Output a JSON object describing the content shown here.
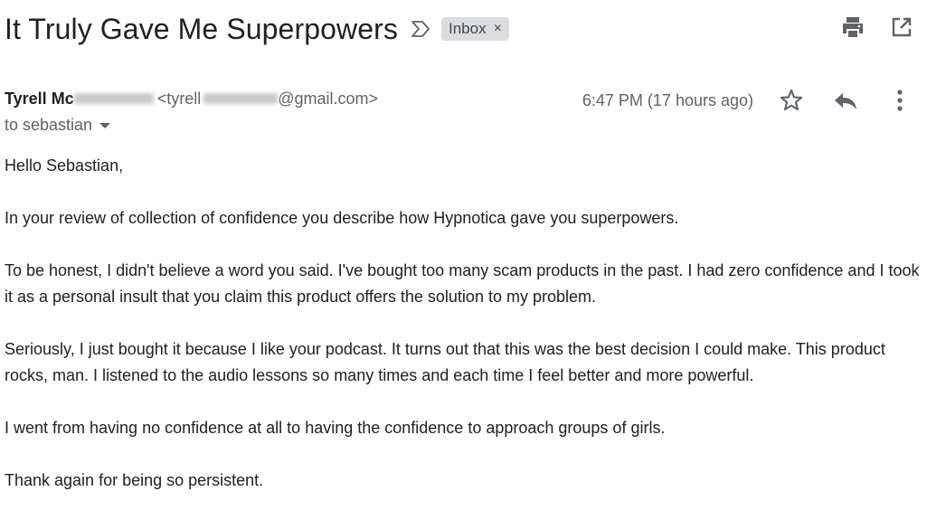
{
  "email": {
    "subject": "It Truly Gave Me Superpowers",
    "label": "Inbox",
    "label_remove": "×",
    "sender_name": "Tyrell Mc",
    "sender_email_prefix": "<tyrell",
    "sender_email_suffix": "@gmail.com>",
    "timestamp": "6:47 PM (17 hours ago)",
    "recipient": "to sebastian",
    "body": [
      "Hello Sebastian,",
      "In your review of collection of confidence you describe how Hypnotica gave you superpowers.",
      "To be honest, I didn't believe a word you said. I've bought too many scam products in the past. I had zero confidence and I took it as a personal insult that you claim this product offers the solution to my problem.",
      "Seriously, I just bought it because I like your podcast. It turns out that this was the best decision I could make. This product rocks, man. I listened to the audio lessons so many times and each time I feel better and more powerful.",
      "I went from having no confidence at all to having the confidence to approach groups of girls.",
      "Thank again for being so persistent."
    ]
  },
  "icons": {
    "important": "important-marker-icon",
    "print": "print-icon",
    "open_new_window": "open-in-new-window-icon",
    "star": "star-icon",
    "reply": "reply-icon",
    "more": "more-vertical-icon",
    "recipient_dropdown": "chevron-down-icon"
  },
  "colors": {
    "text": "#202124",
    "secondary_text": "#5f6368",
    "chip_bg": "#dadce0"
  }
}
